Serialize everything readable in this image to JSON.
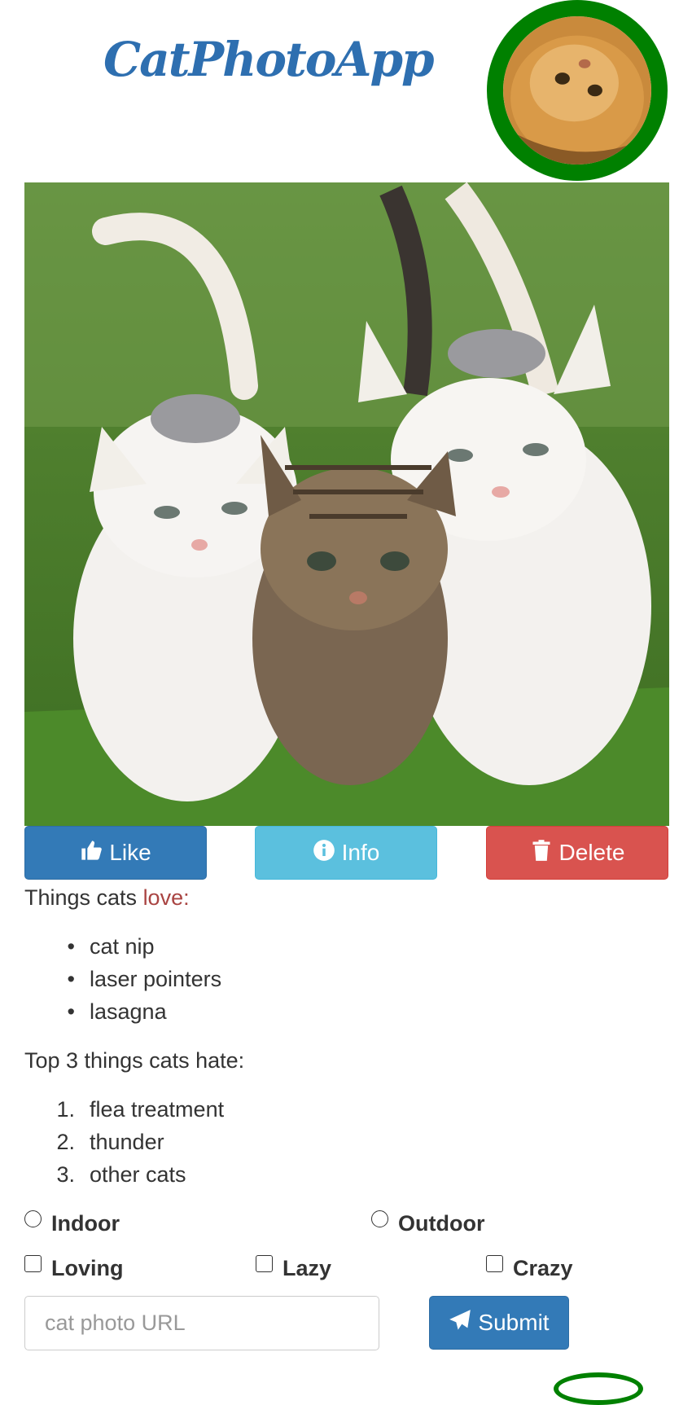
{
  "header": {
    "title": "CatPhotoApp"
  },
  "buttons": {
    "like": "Like",
    "info": "Info",
    "delete": "Delete"
  },
  "love_section": {
    "prefix": "Things cats ",
    "highlight": "love:",
    "items": [
      "cat nip",
      "laser pointers",
      "lasagna"
    ]
  },
  "hate_section": {
    "heading": "Top 3 things cats hate:",
    "items": [
      "flea treatment",
      "thunder",
      "other cats"
    ],
    "numbers": [
      "1.",
      "2.",
      "3."
    ]
  },
  "form": {
    "radios": [
      "Indoor",
      "Outdoor"
    ],
    "checkboxes": [
      "Loving",
      "Lazy",
      "Crazy"
    ],
    "url_placeholder": "cat photo URL",
    "submit_label": "Submit"
  },
  "colors": {
    "title": "#2e6fb0",
    "avatar_border": "#008000",
    "like": "#337ab7",
    "info": "#5bc0de",
    "delete": "#d9534f",
    "love_text": "#a94442"
  },
  "icons": {
    "like": "thumbs-up-icon",
    "info": "info-circle-icon",
    "delete": "trash-icon",
    "submit": "paper-plane-icon"
  }
}
